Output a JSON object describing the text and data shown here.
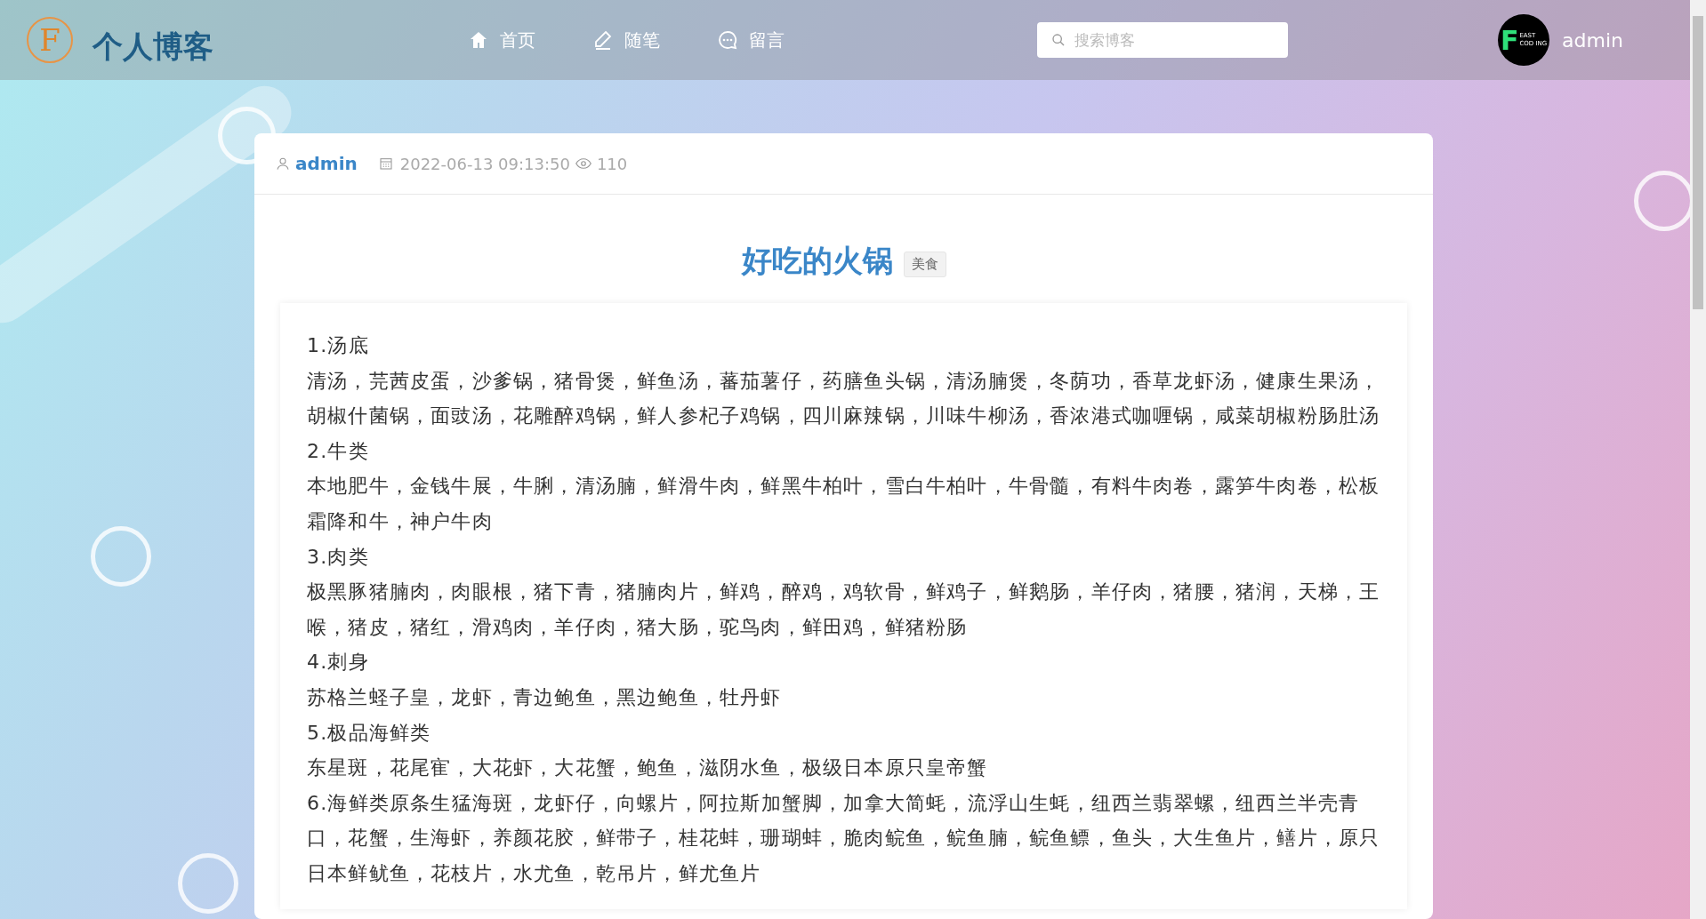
{
  "header": {
    "logo_letter": "F",
    "site_title": "个人博客",
    "nav": [
      {
        "kind": "home",
        "label": "首页"
      },
      {
        "kind": "pen",
        "label": "随笔"
      },
      {
        "kind": "chat",
        "label": "留言"
      }
    ],
    "search": {
      "placeholder": "搜索博客"
    },
    "avatar": {
      "letter": "F",
      "top": "EAST",
      "bottom": "COD ING"
    },
    "user": "admin"
  },
  "post": {
    "author": "admin",
    "date": "2022-06-13 09:13:50",
    "views": "110",
    "title": "好吃的火锅",
    "tag": "美食",
    "sections": [
      {
        "heading": "1.汤底",
        "text": "清汤，芫茜皮蛋，沙爹锅，猪骨煲，鲜鱼汤，蕃茄薯仔，药膳鱼头锅，清汤腩煲，冬荫功，香草龙虾汤，健康生果汤，胡椒什菌锅，面豉汤，花雕醉鸡锅，鲜人参杞子鸡锅，四川麻辣锅，川味牛柳汤，香浓港式咖喱锅，咸菜胡椒粉肠肚汤"
      },
      {
        "heading": "2.牛类",
        "text": "本地肥牛，金钱牛展，牛脷，清汤腩，鲜滑牛肉，鲜黑牛柏叶，雪白牛柏叶，牛骨髓，有料牛肉卷，露笋牛肉卷，松板霜降和牛，神户牛肉"
      },
      {
        "heading": "3.肉类",
        "text": "极黑豚猪腩肉，肉眼根，猪下青，猪腩肉片，鲜鸡，醉鸡，鸡软骨，鲜鸡子，鲜鹅肠，羊仔肉，猪腰，猪润，天梯，王喉，猪皮，猪红，滑鸡肉，羊仔肉，猪大肠，驼鸟肉，鲜田鸡，鲜猪粉肠"
      },
      {
        "heading": "4.刺身",
        "text": "苏格兰蛏子皇，龙虾，青边鲍鱼，黑边鲍鱼，牡丹虾"
      },
      {
        "heading": "5.极品海鲜类",
        "text": "东星斑，花尾寉，大花虾，大花蟹，鲍鱼，滋阴水鱼，极级日本原只皇帝蟹"
      },
      {
        "heading": "6.海鲜类原条生猛海斑，龙虾仔，向螺片，阿拉斯加蟹脚，加拿大简蚝，流浮山生蚝，纽西兰翡翠螺，纽西兰半壳青口，花蟹，生海虾，养颜花胶，鲜带子，桂花蚌，珊瑚蚌，脆肉鲩鱼，鲩鱼腩，鲩鱼鳔，鱼头，大生鱼片，鳝片，原只日本鲜鱿鱼，花枝片，水尤鱼，乾吊片，鲜尤鱼片"
      }
    ]
  }
}
